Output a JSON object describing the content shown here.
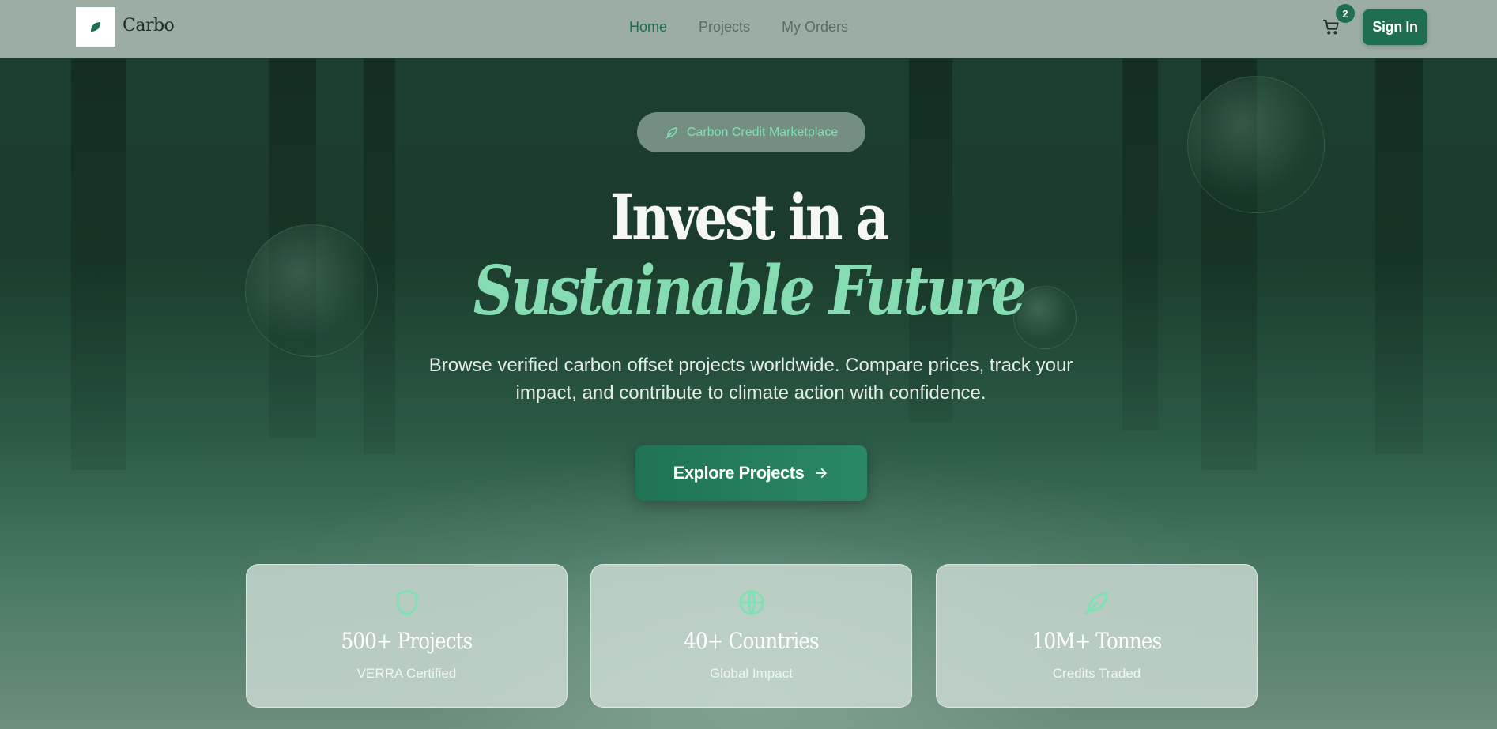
{
  "nav": {
    "brand": "Carbo",
    "links": [
      {
        "label": "Home",
        "active": true
      },
      {
        "label": "Projects",
        "active": false
      },
      {
        "label": "My Orders",
        "active": false
      }
    ],
    "cart_count": "2",
    "signin_label": "Sign In"
  },
  "hero": {
    "badge": "Carbon Credit Marketplace",
    "headline_line1": "Invest in a",
    "headline_line2": "Sustainable Future",
    "subtitle": "Browse verified carbon offset projects worldwide. Compare prices, track your impact, and contribute to climate action with confidence.",
    "cta_label": "Explore Projects"
  },
  "stats": [
    {
      "icon": "shield-icon",
      "title": "500+ Projects",
      "subtitle": "VERRA Certified"
    },
    {
      "icon": "globe-icon",
      "title": "40+ Countries",
      "subtitle": "Global Impact"
    },
    {
      "icon": "leaf-icon",
      "title": "10M+ Tonnes",
      "subtitle": "Credits Traded"
    }
  ],
  "colors": {
    "accent": "#1f6e50",
    "accent_light": "#86dcb2",
    "nav_bg": "#9caea3"
  }
}
